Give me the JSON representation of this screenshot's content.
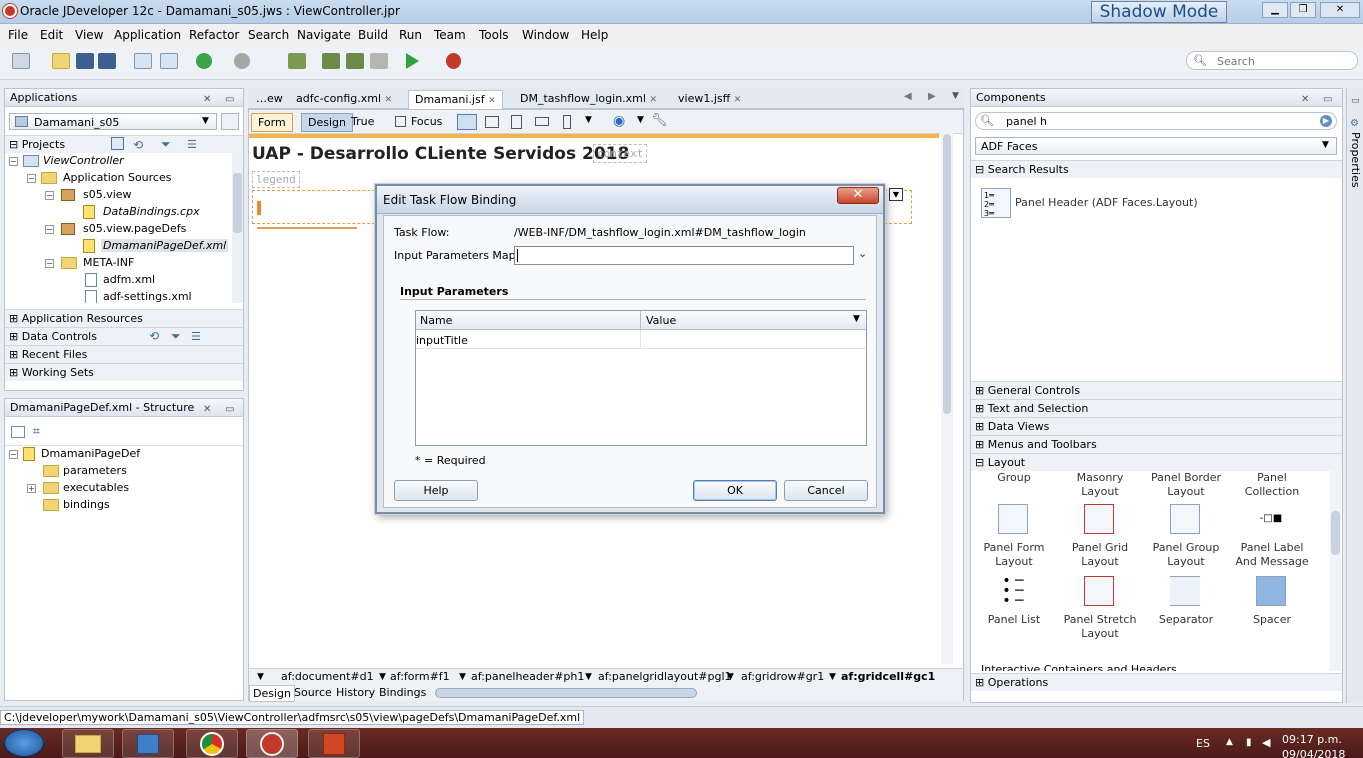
{
  "window": {
    "title": "Oracle JDeveloper 12c - Damamani_s05.jws : ViewController.jpr",
    "shadow_mode": "Shadow Mode",
    "minimize": "▁",
    "maximize": "❐",
    "close": "✕"
  },
  "menu": [
    "File",
    "Edit",
    "View",
    "Application",
    "Refactor",
    "Search",
    "Navigate",
    "Build",
    "Run",
    "Team",
    "Tools",
    "Window",
    "Help"
  ],
  "toolbar": {
    "search_placeholder": "Search"
  },
  "applications": {
    "header": "Applications",
    "app_selector": "Damamani_s05",
    "projects_label": "Projects",
    "tree": [
      "ViewController",
      "Application Sources",
      "s05.view",
      "DataBindings.cpx",
      "s05.view.pageDefs",
      "DmamaniPageDef.xml",
      "META-INF",
      "adfm.xml",
      "adf-settings.xml"
    ],
    "sections": [
      "Application Resources",
      "Data Controls",
      "Recent Files",
      "Working Sets"
    ]
  },
  "structure": {
    "header": "DmamaniPageDef.xml - Structure",
    "tree": [
      "DmamaniPageDef",
      "parameters",
      "executables",
      "bindings"
    ]
  },
  "editor": {
    "tabs": [
      "…ew",
      "adfc-config.xml",
      "Dmamani.jsf",
      "DM_tashflow_login.xml",
      "view1.jsff"
    ],
    "toolbar": {
      "form": "Form",
      "design": "Design",
      "true": "True",
      "focus": "Focus"
    },
    "page_title": "UAP - Desarrollo CLiente Servidos 2018",
    "context_ghost": "context",
    "legend_ghost": "legend",
    "breadcrumbs": [
      "af:document#d1",
      "af:form#f1",
      "af:panelheader#ph1",
      "af:panelgridlayout#pgl1",
      "af:gridrow#gr1",
      "af:gridcell#gc1"
    ],
    "bottom_tabs": [
      "Design",
      "Source",
      "History",
      "Bindings"
    ]
  },
  "dialog": {
    "title": "Edit Task Flow Binding",
    "close": "✕",
    "task_flow_label": "Task Flow:",
    "task_flow_value": "/WEB-INF/DM_tashflow_login.xml#DM_tashflow_login",
    "input_map_label": "Input Parameters Map:",
    "input_map_value": "",
    "section": "Input Parameters",
    "columns": [
      "Name",
      "Value"
    ],
    "rows": [
      {
        "name": "inputTitle",
        "value": ""
      }
    ],
    "required_note": "* = Required",
    "help": "Help",
    "ok": "OK",
    "cancel": "Cancel"
  },
  "components": {
    "header": "Components",
    "search_value": "panel h",
    "library": "ADF Faces",
    "results_label": "Search Results",
    "result": "Panel Header (ADF Faces.Layout)",
    "categories": [
      "General Controls",
      "Text and Selection",
      "Data Views",
      "Menus and Toolbars",
      "Layout"
    ],
    "layout_top": [
      "Group",
      "Masonry Layout",
      "Panel Border Layout",
      "Panel Collection"
    ],
    "layout_row1": [
      "Panel Form Layout",
      "Panel Grid Layout",
      "Panel Group Layout",
      "Panel Label And Message"
    ],
    "layout_row2": [
      "Panel List",
      "Panel Stretch Layout",
      "Separator",
      "Spacer"
    ],
    "interactive_label": "Interactive Containers and Headers",
    "operations": "Operations",
    "properties_tab": "Properties"
  },
  "status": {
    "path": "C:\\jdeveloper\\mywork\\Damamani_s05\\ViewController\\adfmsrc\\s05\\view\\pageDefs\\DmamaniPageDef.xml"
  },
  "taskbar": {
    "lang": "ES",
    "time": "09:17 p.m.",
    "date": "09/04/2018"
  }
}
